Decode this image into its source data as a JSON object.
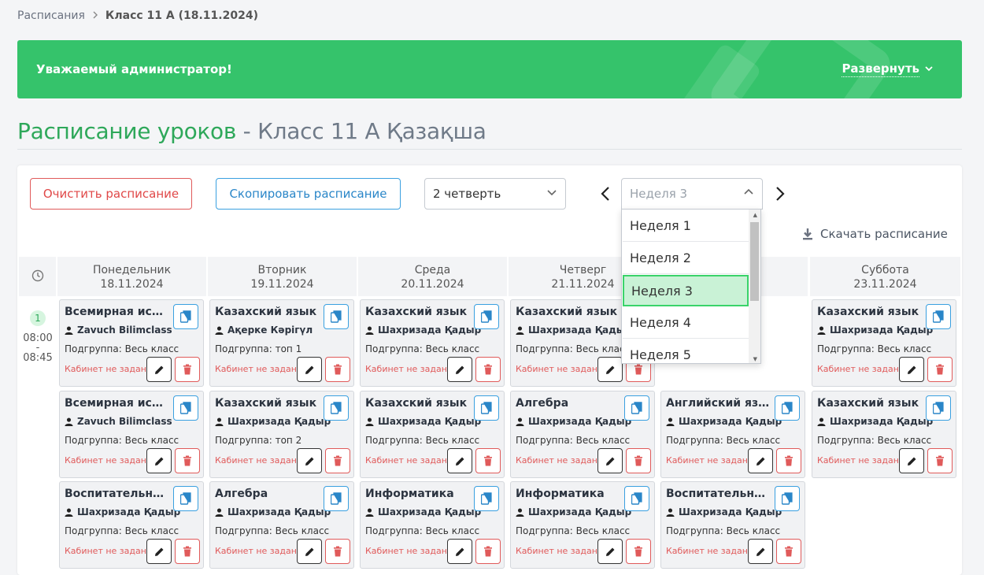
{
  "breadcrumb": {
    "root": "Расписания",
    "current": "Класс 11 А (18.11.2024)"
  },
  "banner": {
    "greeting": "Уважаемый администратор!",
    "expand_label": "Развернуть"
  },
  "title": {
    "main": "Расписание уроков",
    "dash": "-",
    "class": "Класс 11 А Қазақша"
  },
  "toolbar": {
    "clear_label": "Очистить расписание",
    "copy_label": "Скопировать расписание",
    "quarter_value": "2 четверть",
    "week_placeholder": "Неделя 3",
    "download_label": "Скачать расписание"
  },
  "week_options": [
    "Неделя 1",
    "Неделя 2",
    "Неделя 3",
    "Неделя 4",
    "Неделя 5"
  ],
  "selected_week": "Неделя 3",
  "days": [
    {
      "name": "Понедельник",
      "date": "18.11.2024"
    },
    {
      "name": "Вторник",
      "date": "19.11.2024"
    },
    {
      "name": "Среда",
      "date": "20.11.2024"
    },
    {
      "name": "Четверг",
      "date": "21.11.2024"
    },
    {
      "name": "",
      "date": ""
    },
    {
      "name": "Суббота",
      "date": "23.11.2024"
    }
  ],
  "slot1": {
    "num": "1",
    "start": "08:00",
    "dash": "-",
    "end": "08:45"
  },
  "labels": {
    "subgroup_prefix": "Подгруппа: ",
    "room": "Кабинет не задан"
  },
  "lessons": [
    [
      {
        "subject": "Всемирная история",
        "teacher": "Zavuch Bilimclass",
        "subgroup": "Подгруппа: Весь класс"
      },
      {
        "subject": "Всемирная история",
        "teacher": "Zavuch Bilimclass",
        "subgroup": "Подгруппа: Весь класс"
      },
      {
        "subject": "Воспитательный час",
        "teacher": "Шахризада Қадыр",
        "subgroup": "Подгруппа: Весь класс"
      }
    ],
    [
      {
        "subject": "Казахский язык",
        "teacher": "Ақерке Кәрігүл",
        "subgroup": "Подгруппа: топ 1"
      },
      {
        "subject": "Казахский язык",
        "teacher": "Шахризада Қадыр",
        "subgroup": "Подгруппа: топ 2"
      },
      {
        "subject": "Алгебра",
        "teacher": "Шахризада Қадыр",
        "subgroup": "Подгруппа: Весь класс"
      }
    ],
    [
      {
        "subject": "Казахский язык",
        "teacher": "Шахризада Қадыр",
        "subgroup": "Подгруппа: Весь класс"
      },
      {
        "subject": "Казахский язык",
        "teacher": "Шахризада Қадыр",
        "subgroup": "Подгруппа: Весь класс"
      },
      {
        "subject": "Информатика",
        "teacher": "Шахризада Қадыр",
        "subgroup": "Подгруппа: Весь класс"
      }
    ],
    [
      {
        "subject": "Казахский язык",
        "teacher": "Шахризада Қадыр",
        "subgroup": "Подгруппа: Весь класс"
      },
      {
        "subject": "Алгебра",
        "teacher": "Шахризада Қадыр",
        "subgroup": "Подгруппа: Весь класс"
      },
      {
        "subject": "Информатика",
        "teacher": "Шахризада Қадыр",
        "subgroup": "Подгруппа: Весь класс"
      }
    ],
    [
      {
        "subject": "",
        "teacher": "",
        "subgroup": ""
      },
      {
        "subject": "Английский язык",
        "teacher": "Шахризада Қадыр",
        "subgroup": "Подгруппа: Весь класс"
      },
      {
        "subject": "Воспитательный час",
        "teacher": "Шахризада Қадыр",
        "subgroup": "Подгруппа: Весь класс"
      }
    ],
    [
      {
        "subject": "Казахский язык",
        "teacher": "Шахризада Қадыр",
        "subgroup": "Подгруппа: Весь класс"
      },
      {
        "subject": "Казахский язык",
        "teacher": "Шахризада Қадыр",
        "subgroup": "Подгруппа: Весь класс"
      }
    ]
  ],
  "colors": {
    "brand_green": "#35c36b",
    "danger": "#e05a5a",
    "info": "#3aa0e0"
  }
}
